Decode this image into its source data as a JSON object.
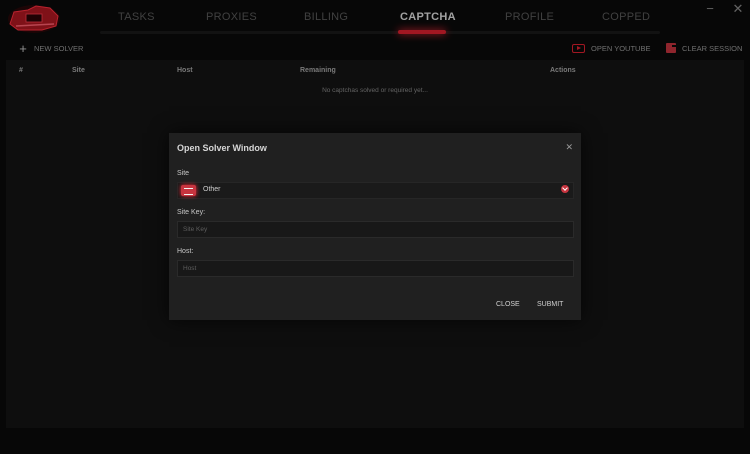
{
  "nav": {
    "tabs": [
      {
        "label": "TASKS"
      },
      {
        "label": "PROXIES"
      },
      {
        "label": "BILLING"
      },
      {
        "label": "CAPTCHA"
      },
      {
        "label": "PROFILE"
      },
      {
        "label": "COPPED"
      }
    ],
    "active_tab": "CAPTCHA"
  },
  "window_controls": {
    "minimize": "−",
    "close": "✕"
  },
  "toolbar": {
    "new_solver": {
      "label": "NEW SOLVER",
      "icon": "plus-icon"
    },
    "open_youtube": {
      "label": "OPEN YOUTUBE",
      "icon": "youtube-icon"
    },
    "clear_session": {
      "label": "CLEAR SESSION",
      "icon": "trash-icon"
    }
  },
  "table": {
    "columns": [
      "#",
      "Site",
      "Host",
      "Remaining",
      "Actions"
    ],
    "empty_message": "No captchas solved or required yet..."
  },
  "modal": {
    "title": "Open Solver Window",
    "close_glyph": "✕",
    "site_label": "Site",
    "site_value": "Other",
    "site_key_label": "Site Key:",
    "site_key_placeholder": "Site Key",
    "site_key_value": "",
    "host_label": "Host:",
    "host_placeholder": "Host",
    "host_value": "",
    "close_button": "CLOSE",
    "submit_button": "SUBMIT"
  },
  "colors": {
    "accent": "#e02030",
    "background": "#0b0b0b",
    "panel": "#141414",
    "modal": "#202020"
  }
}
